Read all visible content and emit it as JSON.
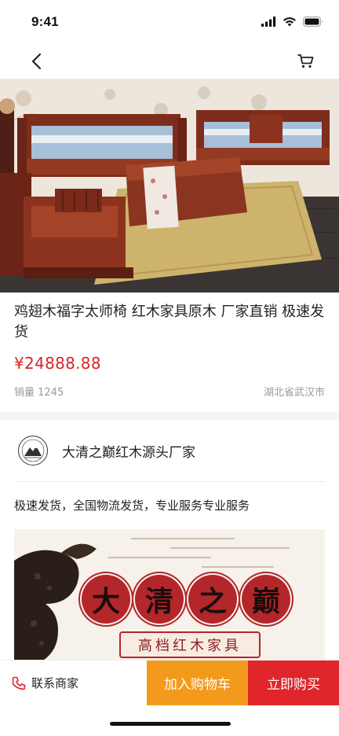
{
  "status_bar": {
    "time": "9:41"
  },
  "nav": {
    "back_icon": "chevron-left-icon",
    "cart_icon": "cart-icon"
  },
  "product": {
    "title": "鸡翅木福字太师椅 红木家具原木 厂家直销 极速发货",
    "price": "¥24888.88",
    "sales": "销量 1245",
    "location": "湖北省武汉市"
  },
  "shop": {
    "name": "大清之巅红木源头厂家",
    "logo_icon": "mountain-badge-icon"
  },
  "description": "极速发货，全国物流发货，专业服务专业服务",
  "banner": {
    "chars": [
      "大",
      "清",
      "之",
      "巅"
    ],
    "subtitle": "高档红木家具"
  },
  "actions": {
    "contact_label": "联系商家",
    "add_to_cart_label": "加入购物车",
    "buy_now_label": "立即购买"
  },
  "colors": {
    "price": "#d7262b",
    "add_to_cart": "#f39a1c",
    "buy_now": "#e0252b",
    "seal": "#b3262a"
  }
}
